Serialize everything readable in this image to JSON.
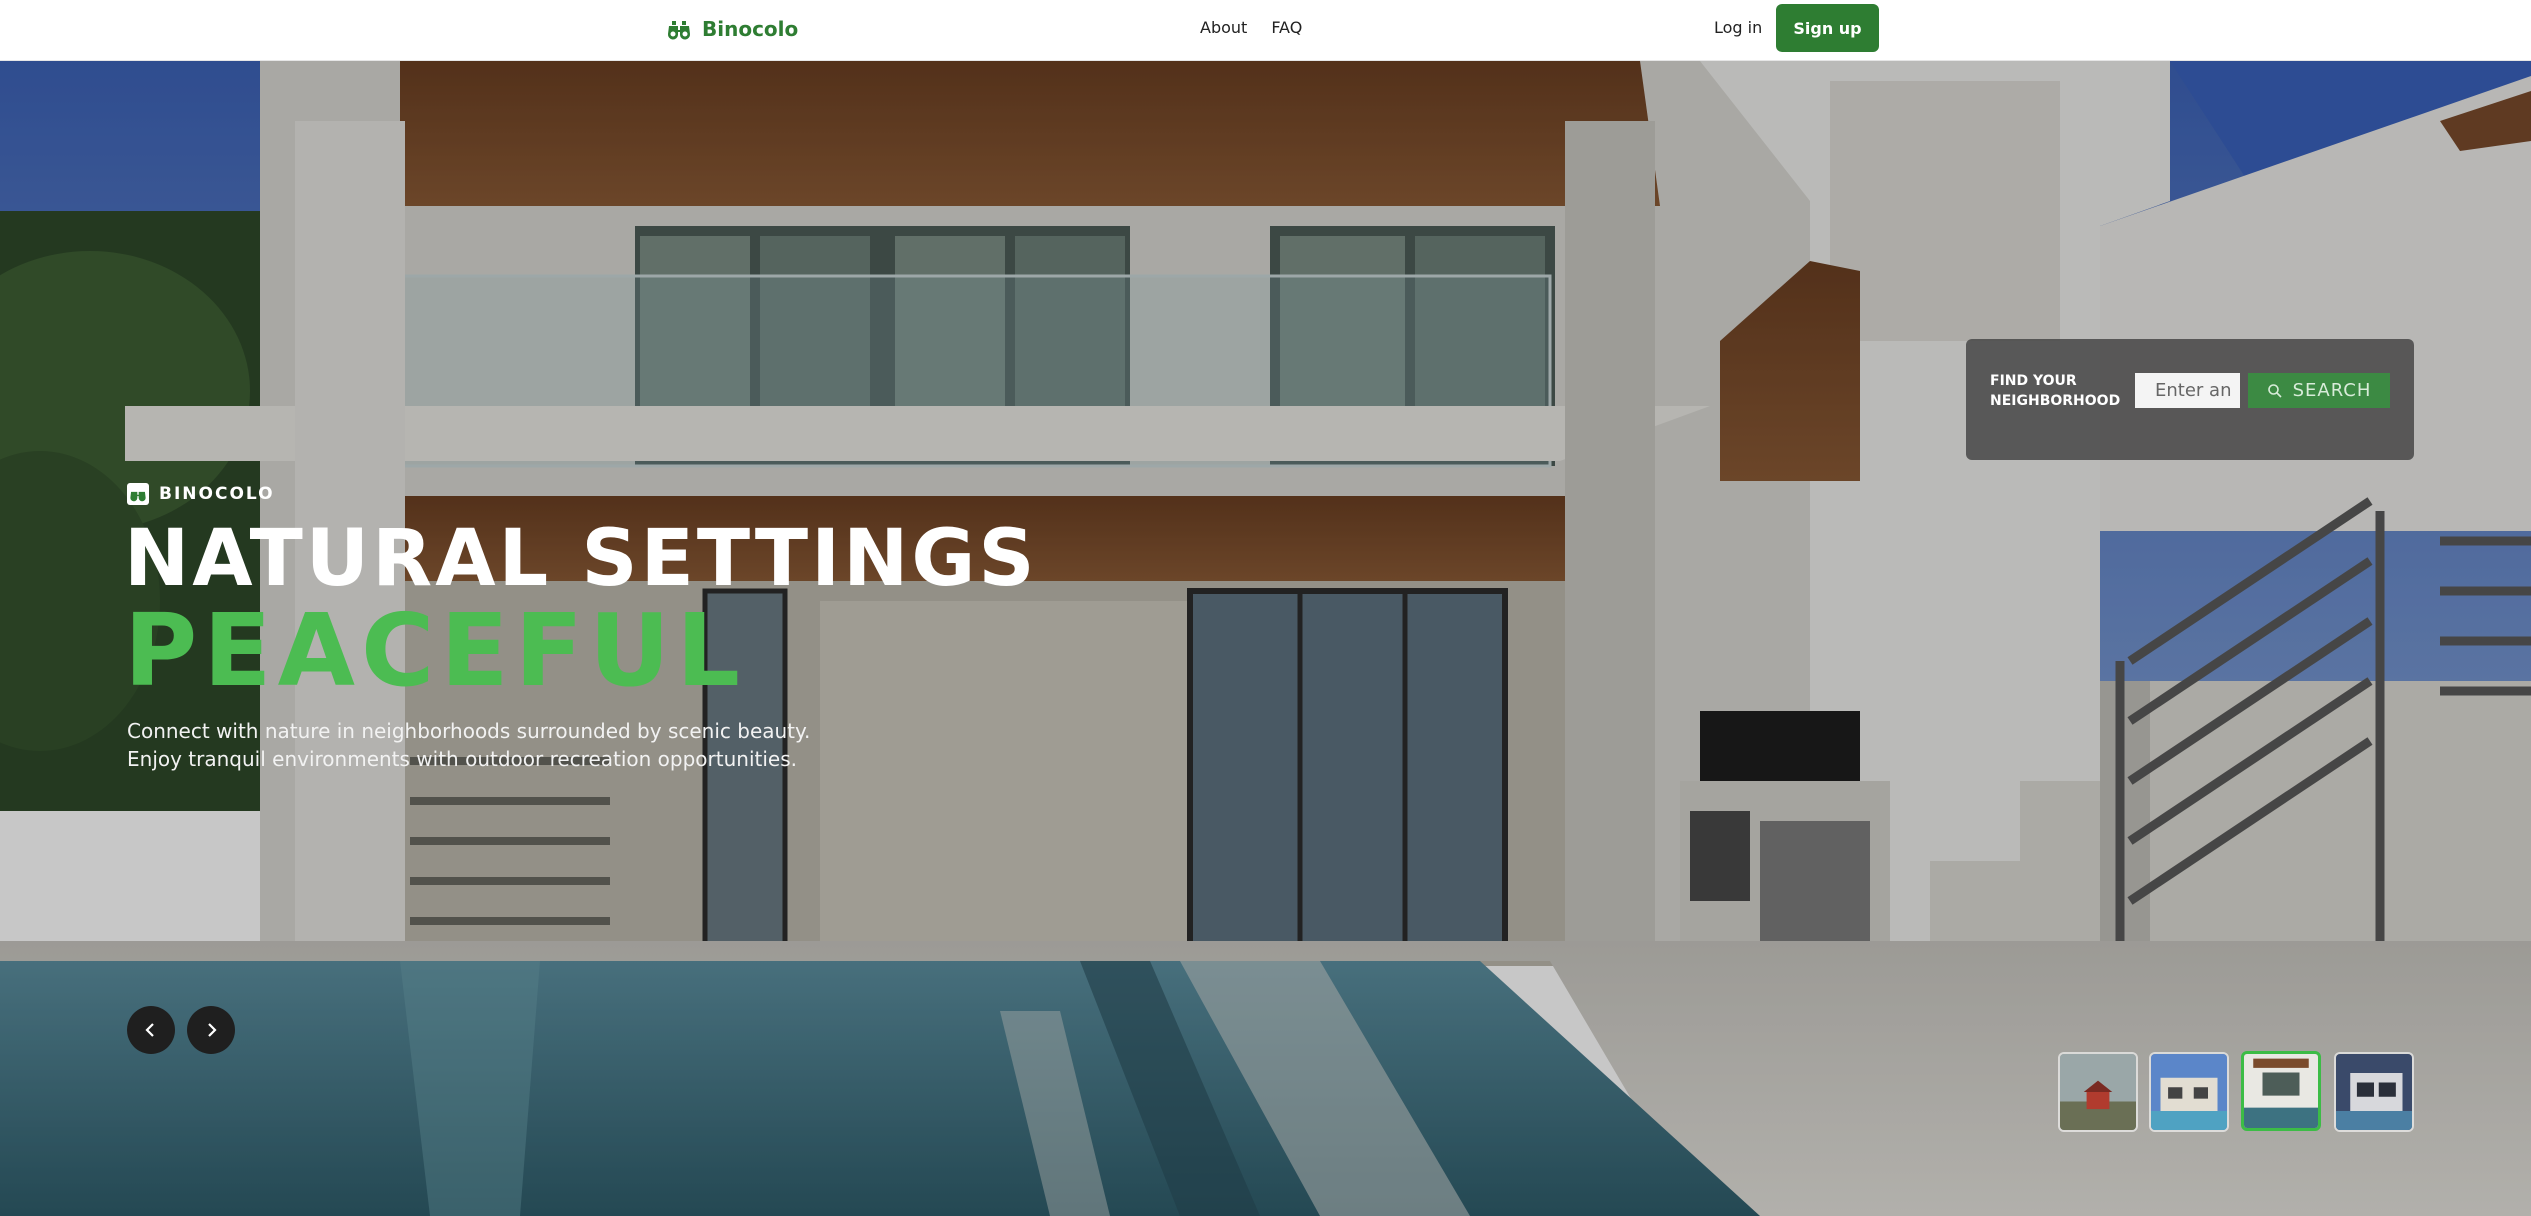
{
  "header": {
    "logo_text": "Binocolo",
    "nav": [
      {
        "label": "About"
      },
      {
        "label": "FAQ"
      }
    ],
    "login_label": "Log in",
    "signup_label": "Sign up"
  },
  "hero": {
    "brand_tag": "BINOCOLO",
    "title": "NATURAL SETTINGS",
    "accent": "PEACEFUL",
    "description": "Connect with nature in neighborhoods surrounded by scenic beauty. Enjoy tranquil environments with outdoor recreation opportunities.",
    "active_slide": 3
  },
  "search": {
    "label": "FIND YOUR NEIGHBORHOOD",
    "placeholder": "Enter an",
    "button_label": "SEARCH"
  },
  "slider": {
    "prev_icon": "chevron-left-icon",
    "next_icon": "chevron-right-icon",
    "thumbnails": [
      {
        "name": "small-red-cabin",
        "active": false
      },
      {
        "name": "modern-villa-pool",
        "active": false
      },
      {
        "name": "white-house-pool",
        "active": true
      },
      {
        "name": "contemporary-house-night",
        "active": false
      }
    ]
  },
  "colors": {
    "brand_green": "#2e7d32",
    "accent_green": "#4cbc52",
    "search_button": "#3c8a43",
    "active_thumb_border": "#3cbc46"
  }
}
